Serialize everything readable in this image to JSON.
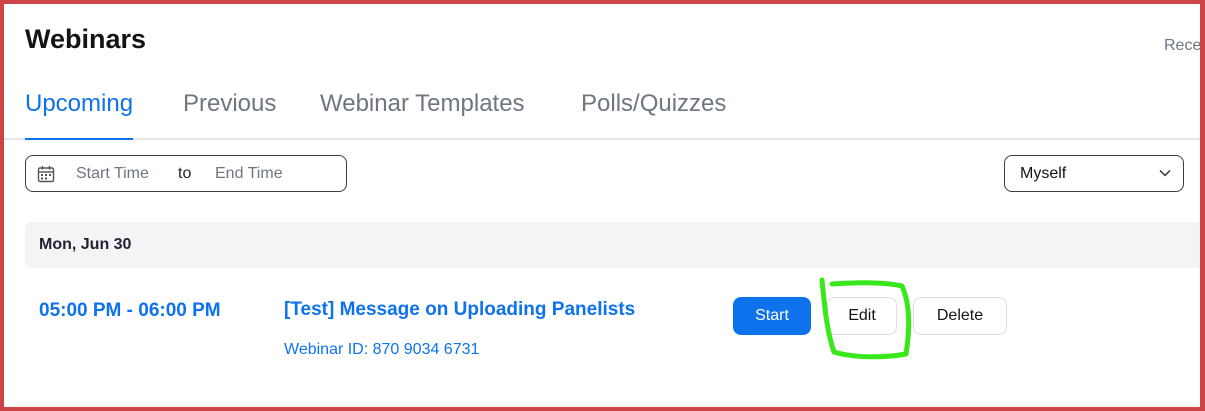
{
  "page": {
    "title": "Webinars",
    "recent_label": "Rece"
  },
  "tabs": [
    {
      "label": "Upcoming",
      "active": true
    },
    {
      "label": "Previous",
      "active": false
    },
    {
      "label": "Webinar Templates",
      "active": false
    },
    {
      "label": "Polls/Quizzes",
      "active": false
    }
  ],
  "filter": {
    "start_placeholder": "Start Time",
    "separator": "to",
    "end_placeholder": "End Time",
    "calendar_icon": "calendar-icon"
  },
  "owner_select": {
    "value": "Myself",
    "icon": "chevron-down-icon"
  },
  "schedule": {
    "date_header": "Mon, Jun 30",
    "webinar": {
      "time": "05:00 PM - 06:00 PM",
      "topic": "[Test] Message on Uploading Panelists",
      "webinar_id": "Webinar ID: 870 9034 6731",
      "start_label": "Start",
      "edit_label": "Edit",
      "delete_label": "Delete"
    }
  },
  "colors": {
    "accent": "#0e72ed",
    "frame_border": "#cc4444",
    "annotation": "#39e81a"
  }
}
